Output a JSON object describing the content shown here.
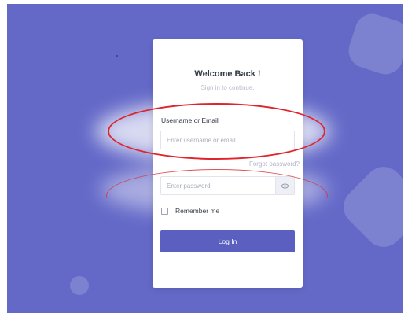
{
  "login": {
    "title": "Welcome Back !",
    "subtitle": "Sign in to continue.",
    "username_label": "Username or Email",
    "username_placeholder": "Enter username or email",
    "forgot_password": "Forgot password?",
    "password_placeholder": "Enter password",
    "remember_label": "Remember me",
    "login_button": "Log In"
  },
  "icons": {
    "password_toggle": "eye-icon"
  },
  "colors": {
    "background": "#6469c8",
    "primary_button": "#5a5fc0",
    "annotation": "#e0242b"
  }
}
